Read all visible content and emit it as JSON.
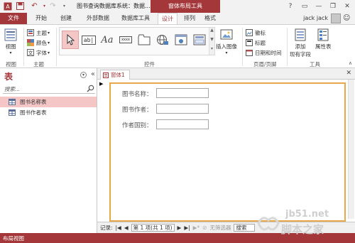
{
  "titlebar": {
    "title": "图书查询数据库系统：数据...",
    "tool_header": "窗体布局工具"
  },
  "tabs": {
    "file": "文件",
    "home": "开始",
    "create": "创建",
    "external": "外部数据",
    "dbtools": "数据库工具",
    "design": "设计",
    "arrange": "排列",
    "format": "格式",
    "user": "jack jack"
  },
  "ribbon": {
    "view": {
      "view_btn": "视图",
      "group": "视图"
    },
    "theme": {
      "themes": "主题",
      "colors": "颜色",
      "fonts": "字体",
      "group": "主题"
    },
    "controls": {
      "insert_image": "插入图像",
      "group": "控件",
      "textbox": "ab|",
      "label": "Aa",
      "button": "xxxx"
    },
    "header_footer": {
      "logo": "徽标",
      "title": "标题",
      "datetime": "日期和时间",
      "group": "页眉/页脚"
    },
    "tools": {
      "add_fields_line1": "添加",
      "add_fields_line2": "现有字段",
      "property_sheet": "属性表",
      "group": "工具"
    }
  },
  "nav": {
    "title": "表",
    "search_placeholder": "搜索...",
    "items": [
      {
        "label": "图书名称表",
        "selected": true
      },
      {
        "label": "图书作者表",
        "selected": false
      }
    ]
  },
  "document": {
    "tab": "窗体1",
    "fields": [
      {
        "label": "图书名称：",
        "value": ""
      },
      {
        "label": "图书作者：",
        "value": ""
      },
      {
        "label": "作者国别：",
        "value": ""
      }
    ]
  },
  "record_nav": {
    "label": "记录:",
    "position": "第 1 项(共 1 项)",
    "filter": "无筛选器",
    "search": "搜索"
  },
  "status": {
    "text": "布局视图"
  },
  "watermark": {
    "url": "jb51.net",
    "cn": "脚本之家"
  },
  "colors": {
    "accent": "#a4373a",
    "selection": "#f4c6c6",
    "layout_border": "#e8a84a"
  }
}
